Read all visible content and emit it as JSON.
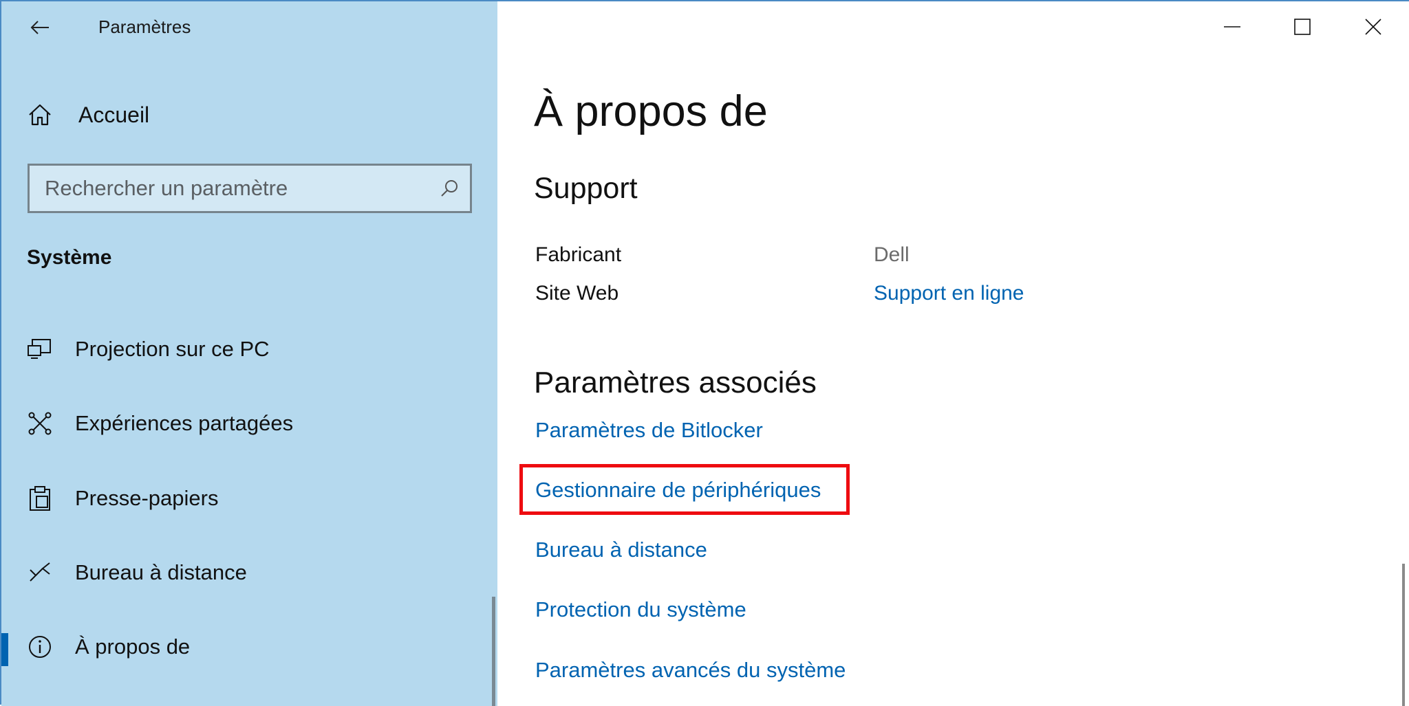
{
  "app": {
    "title": "Paramètres"
  },
  "sidebar": {
    "home_label": "Accueil",
    "search": {
      "placeholder": "Rechercher un paramètre",
      "value": ""
    },
    "section_title": "Système",
    "items": [
      {
        "label": "Projection sur ce PC",
        "icon": "projector-icon"
      },
      {
        "label": "Expériences partagées",
        "icon": "shared-experiences-icon"
      },
      {
        "label": "Presse-papiers",
        "icon": "clipboard-icon"
      },
      {
        "label": "Bureau à distance",
        "icon": "remote-desktop-icon"
      },
      {
        "label": "À propos de",
        "icon": "info-icon",
        "selected": true
      }
    ]
  },
  "main": {
    "page_title": "À propos de",
    "support": {
      "heading": "Support",
      "rows": [
        {
          "key": "Fabricant",
          "value": "Dell"
        },
        {
          "key": "Site Web",
          "value": "Support en ligne"
        }
      ]
    },
    "related": {
      "heading": "Paramètres associés",
      "links": [
        "Paramètres de Bitlocker",
        "Gestionnaire de périphériques",
        "Bureau à distance",
        "Protection du système",
        "Paramètres avancés du système"
      ]
    }
  },
  "colors": {
    "sidebar_bg": "#b5d9ee",
    "link": "#0063b1",
    "highlight": "#ee0c10",
    "accent": "#0063b1"
  }
}
